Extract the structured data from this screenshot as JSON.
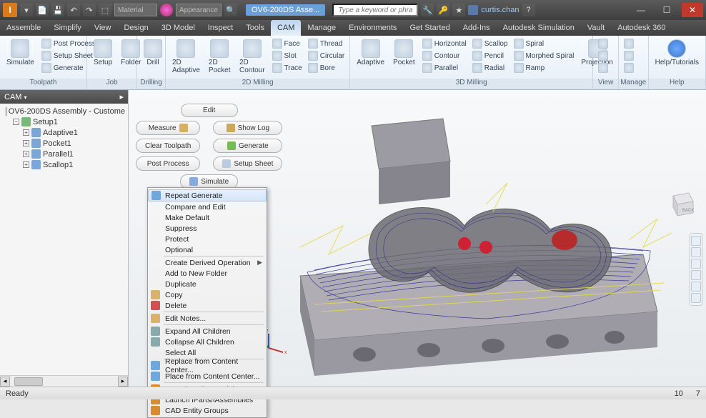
{
  "title": {
    "doc": "OV6-200DS Asse...",
    "search_placeholder": "Type a keyword or phrase",
    "user": "curtis.chan",
    "material_label": "Material",
    "appearance_label": "Appearance"
  },
  "tabs": [
    "Assemble",
    "Simplify",
    "View",
    "Design",
    "3D Model",
    "Inspect",
    "Tools",
    "CAM",
    "Manage",
    "Environments",
    "Get Started",
    "Add-Ins",
    "Autodesk Simulation",
    "Vault",
    "Autodesk 360"
  ],
  "active_tab": "CAM",
  "ribbon": {
    "toolpath": {
      "simulate": "Simulate",
      "post": "Post Process",
      "setup_sheet": "Setup Sheet",
      "generate": "Generate",
      "label": "Toolpath"
    },
    "job": {
      "setup": "Setup",
      "folder": "Folder",
      "label": "Job"
    },
    "drilling": {
      "drill": "Drill",
      "label": "Drilling"
    },
    "mill2d": {
      "adapt": "2D Adaptive",
      "pocket": "2D Pocket",
      "contour": "2D Contour",
      "face": "Face",
      "slot": "Slot",
      "trace": "Trace",
      "thread": "Thread",
      "circular": "Circular",
      "bore": "Bore",
      "label": "2D Milling"
    },
    "mill3d": {
      "adaptive": "Adaptive",
      "pocket": "Pocket",
      "horizontal": "Horizontal",
      "contour": "Contour",
      "parallel": "Parallel",
      "scallop": "Scallop",
      "pencil": "Pencil",
      "radial": "Radial",
      "spiral": "Spiral",
      "morphed": "Morphed Spiral",
      "ramp": "Ramp",
      "projection": "Projection",
      "label": "3D Milling"
    },
    "view": {
      "label": "View"
    },
    "manage": {
      "label": "Manage"
    },
    "help": {
      "help": "Help/Tutorials",
      "label": "Help"
    }
  },
  "browser": {
    "title": "CAM",
    "root": "OV6-200DS Assembly - Custome",
    "setup": "Setup1",
    "items": [
      "Adaptive1",
      "Pocket1",
      "Parallel1",
      "Scallop1"
    ]
  },
  "actions": {
    "edit": "Edit",
    "measure": "Measure",
    "show_log": "Show Log",
    "clear": "Clear Toolpath",
    "generate": "Generate",
    "post": "Post Process",
    "setup_sheet": "Setup Sheet",
    "simulate": "Simulate"
  },
  "context_menu": [
    {
      "label": "Repeat Generate",
      "icon": "#6fa8dc",
      "hl": true
    },
    {
      "label": "Compare and Edit"
    },
    {
      "label": "Make Default"
    },
    {
      "label": "Suppress"
    },
    {
      "label": "Protect"
    },
    {
      "label": "Optional"
    },
    {
      "sep": true
    },
    {
      "label": "Create Derived Operation",
      "sub": true
    },
    {
      "label": "Add to New Folder"
    },
    {
      "label": "Duplicate"
    },
    {
      "label": "Copy",
      "icon": "#d9b36c"
    },
    {
      "label": "Delete",
      "icon": "#d25050"
    },
    {
      "sep": true
    },
    {
      "label": "Edit Notes...",
      "icon": "#d9b36c"
    },
    {
      "sep": true
    },
    {
      "label": "Expand All Children",
      "icon": "#8aa"
    },
    {
      "label": "Collapse All Children",
      "icon": "#8aa"
    },
    {
      "label": "Select All"
    },
    {
      "sep": true
    },
    {
      "label": "Replace from Content Center...",
      "icon": "#6fa8dc"
    },
    {
      "label": "Place from Content Center...",
      "icon": "#6fa8dc"
    },
    {
      "sep": true
    },
    {
      "label": "Launch Active Model",
      "icon": "#d98b2e"
    },
    {
      "label": "Launch iParts/iAssemblies",
      "icon": "#d98b2e"
    },
    {
      "label": "CAD Entity Groups",
      "icon": "#d98b2e"
    }
  ],
  "status": {
    "ready": "Ready",
    "n1": "10",
    "n2": "7"
  }
}
